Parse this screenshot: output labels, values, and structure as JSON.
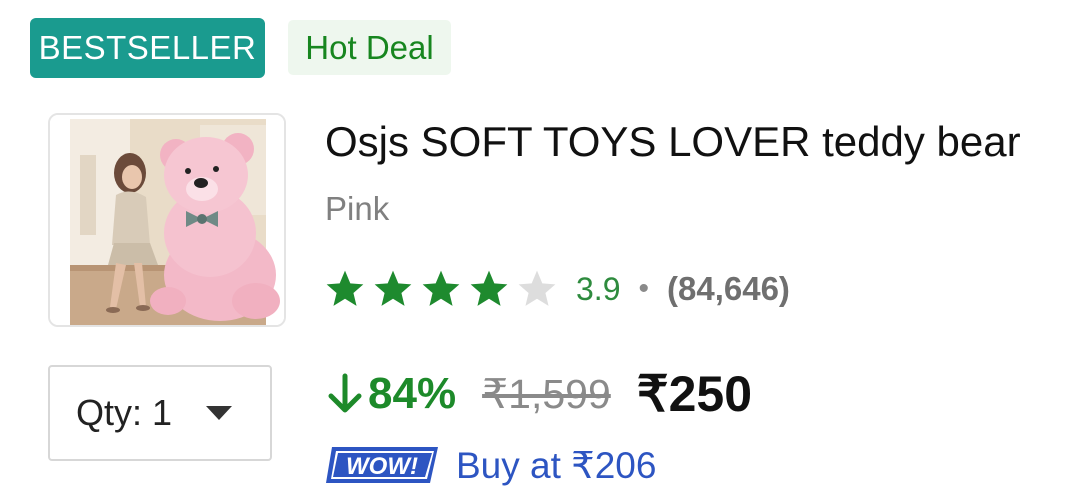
{
  "badges": {
    "bestseller": "BESTSELLER",
    "hot_deal": "Hot Deal"
  },
  "product": {
    "title": "Osjs SOFT TOYS LOVER teddy bear",
    "variant": "Pink",
    "image_alt": "pink-teddy-bear-photo"
  },
  "rating": {
    "value": "3.9",
    "separator": "•",
    "count": "(84,646)",
    "stars_filled": 4,
    "stars_total": 5,
    "star_color": "#1e8a2e",
    "star_empty_color": "#dddddd"
  },
  "quantity": {
    "label": "Qty: 1"
  },
  "pricing": {
    "discount": "84%",
    "mrp": "₹1,599",
    "price": "₹250"
  },
  "offer": {
    "logo_text": "WOW!",
    "buy_at": "Buy at ₹206"
  },
  "colors": {
    "bestseller_bg": "#1a9b8f",
    "hot_deal_text": "#17861f",
    "discount": "#1d8a2a",
    "offer_text": "#2d55c2"
  }
}
